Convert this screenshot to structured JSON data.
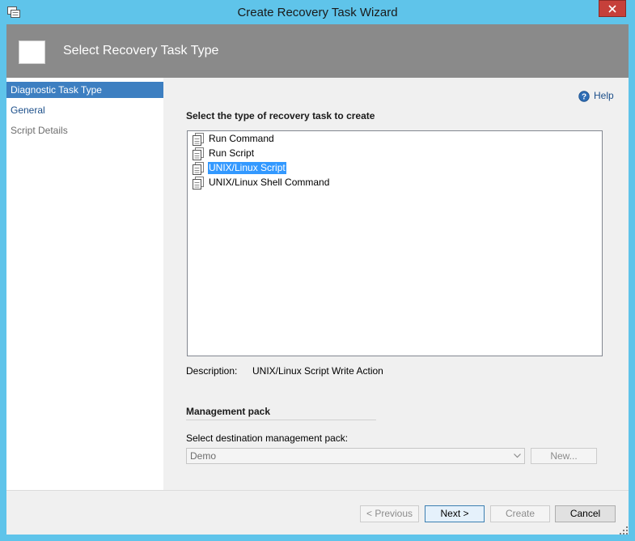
{
  "window": {
    "title": "Create Recovery Task Wizard"
  },
  "header": {
    "title": "Select Recovery Task Type"
  },
  "nav": {
    "items": [
      {
        "label": "Diagnostic Task Type",
        "state": "active"
      },
      {
        "label": "General",
        "state": "link"
      },
      {
        "label": "Script Details",
        "state": "disabled"
      }
    ]
  },
  "help": {
    "label": "Help"
  },
  "task_type": {
    "heading": "Select the type of recovery task to create",
    "items": [
      {
        "label": "Run Command",
        "selected": false
      },
      {
        "label": "Run Script",
        "selected": false
      },
      {
        "label": "UNIX/Linux Script",
        "selected": true
      },
      {
        "label": "UNIX/Linux Shell Command",
        "selected": false
      }
    ],
    "description_label": "Description:",
    "description_value": "UNIX/Linux Script Write Action"
  },
  "management_pack": {
    "heading": "Management pack",
    "field_label": "Select destination management pack:",
    "selected": "Demo",
    "new_button": "New..."
  },
  "buttons": {
    "previous": "< Previous",
    "next": "Next >",
    "create": "Create",
    "cancel": "Cancel"
  },
  "colors": {
    "window_frame": "#5fc4ea",
    "header_band": "#8a8a8a",
    "nav_active": "#3d7fc1",
    "selection": "#3399ff",
    "close_button": "#c6403a"
  }
}
